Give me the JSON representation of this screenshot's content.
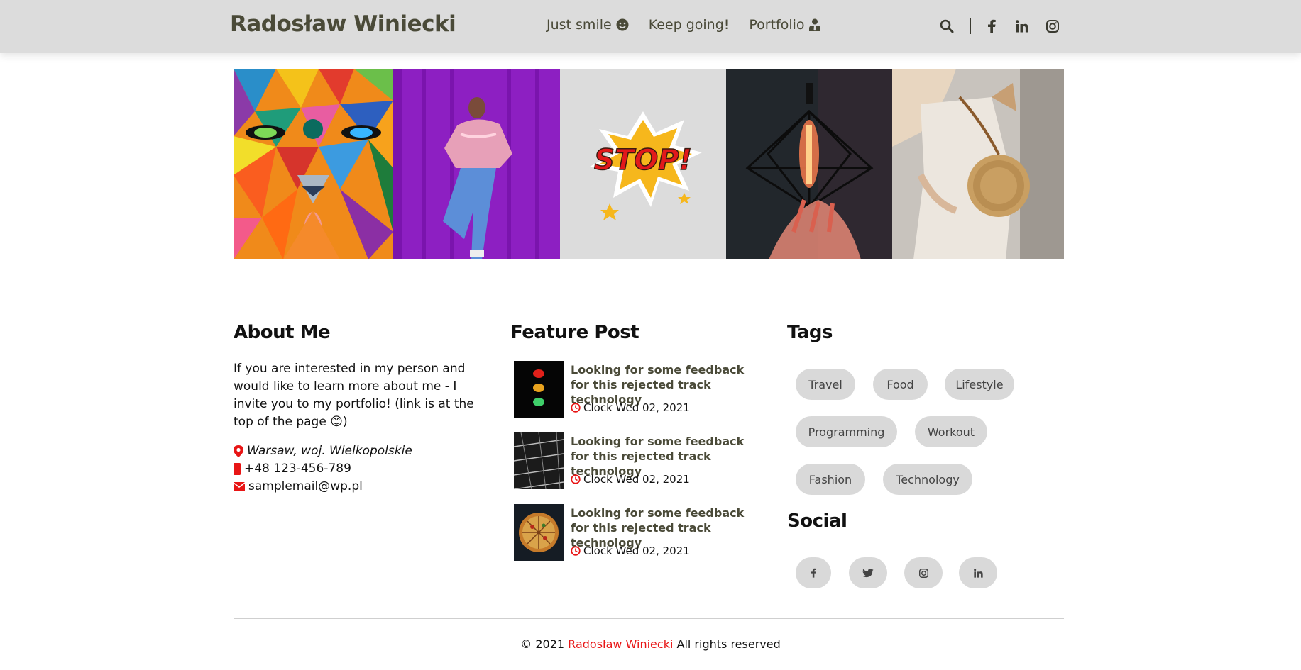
{
  "header": {
    "brand": "Radosław Winiecki",
    "nav": [
      {
        "label": "Just smile",
        "icon": "smile-icon"
      },
      {
        "label": "Keep going!",
        "icon": ""
      },
      {
        "label": "Portfolio",
        "icon": "user-tie-icon"
      }
    ],
    "icons": [
      "search-icon",
      "facebook-icon",
      "linkedin-icon",
      "instagram-icon"
    ]
  },
  "gallery": [
    {
      "name": "colorful-lion-mural"
    },
    {
      "name": "woman-on-purple-wall"
    },
    {
      "name": "stop-sticker"
    },
    {
      "name": "edison-bulb-lamp"
    },
    {
      "name": "woman-with-straw-bag"
    }
  ],
  "about": {
    "title": "About Me",
    "text": "If you are interested in my person and would like to learn more about me - I invite you to my portfolio! (link is at the top of the page 😊)",
    "location": "Warsaw, woj. Wielkopolskie",
    "phone": "+48 123-456-789",
    "email": "samplemail@wp.pl"
  },
  "feature": {
    "title": "Feature Post",
    "posts": [
      {
        "title": "Looking for some feedback for this rejected track technology",
        "date": "Clock Wed 02, 2021"
      },
      {
        "title": "Looking for some feedback for this rejected track technology",
        "date": "Clock Wed 02, 2021"
      },
      {
        "title": "Looking for some feedback for this rejected track technology",
        "date": "Clock Wed 02, 2021"
      }
    ]
  },
  "tags": {
    "title": "Tags",
    "items": [
      "Travel",
      "Food",
      "Lifestyle",
      "Programming",
      "Workout",
      "Fashion",
      "Technology"
    ]
  },
  "social": {
    "title": "Social",
    "items": [
      "facebook-icon",
      "twitter-icon",
      "instagram-icon",
      "linkedin-icon"
    ]
  },
  "footer": {
    "prefix": "© 2021",
    "name": "Radosław Winiecki",
    "suffix": "All rights reserved"
  },
  "colors": {
    "accent": "#e81515",
    "header_bg": "#dcdcdc",
    "tag_bg": "#d9d9d9",
    "brand_text": "#4a4a38"
  }
}
